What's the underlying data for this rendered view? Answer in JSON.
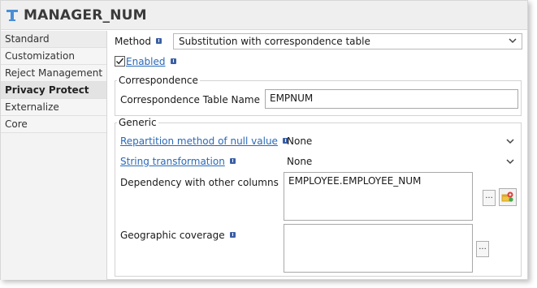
{
  "header": {
    "title": "MANAGER_NUM"
  },
  "sidebar": {
    "items": [
      {
        "label": "Standard"
      },
      {
        "label": "Customization"
      },
      {
        "label": "Reject Management"
      },
      {
        "label": "Privacy Protect"
      },
      {
        "label": "Externalize"
      },
      {
        "label": "Core"
      }
    ],
    "active_index": 3
  },
  "method": {
    "label": "Method",
    "value": "Substitution with correspondence table"
  },
  "enabled": {
    "label": "Enabled",
    "checked": true
  },
  "correspondence": {
    "title": "Correspondence",
    "table_name_label": "Correspondence Table Name",
    "table_name_value": "EMPNUM"
  },
  "generic": {
    "title": "Generic",
    "null_method_label": "Repartition method of null value",
    "null_method_value": "None",
    "string_transform_label": "String transformation",
    "string_transform_value": "None",
    "dependency_label": "Dependency with other columns",
    "dependency_value": "EMPLOYEE.EMPLOYEE_NUM",
    "dependency_button": "...",
    "geo_label": "Geographic coverage",
    "geo_value": "",
    "geo_button": "..."
  },
  "colors": {
    "link": "#2a69b8",
    "info_icon": "#3b5fa5",
    "accent_icon": "#4a8fd6"
  }
}
